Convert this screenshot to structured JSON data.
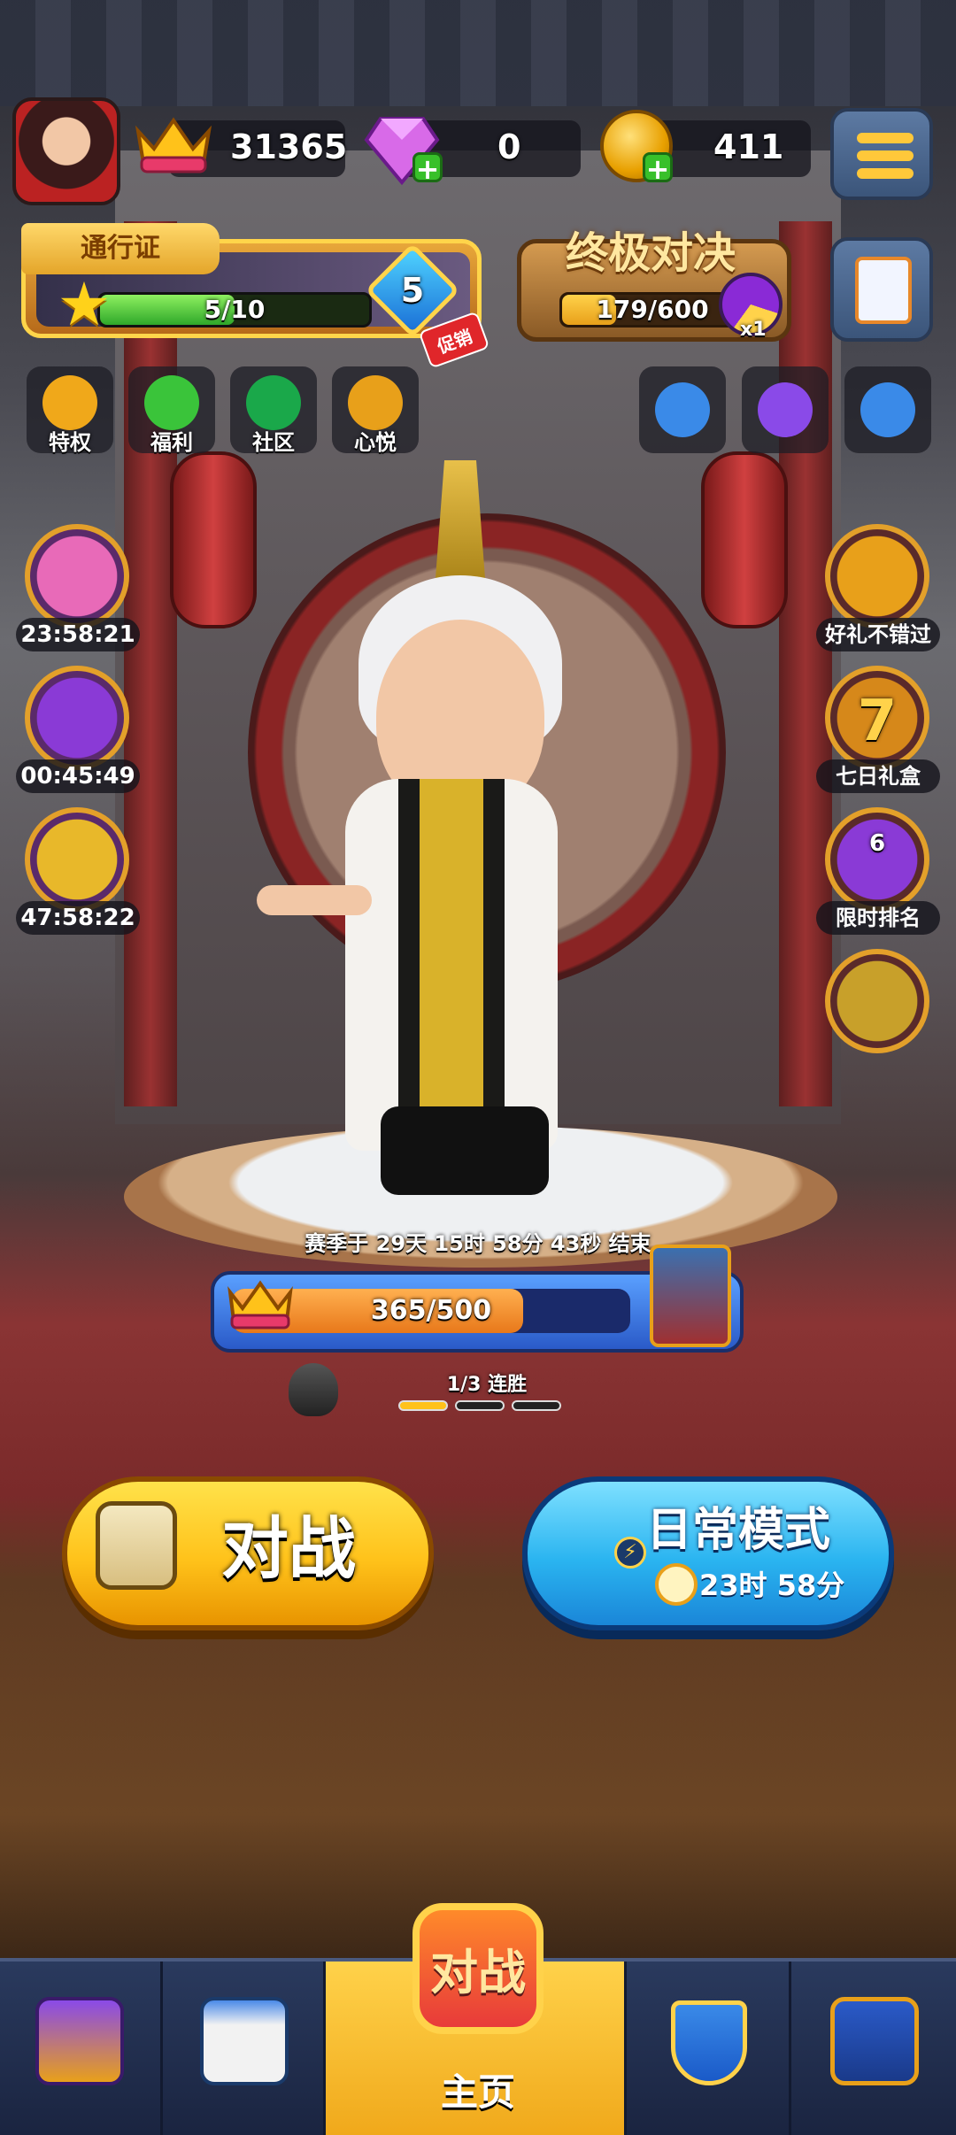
{
  "header": {
    "crowns": "31365",
    "gems": "0",
    "coins": "411"
  },
  "pass": {
    "label": "通行证",
    "progress_text": "5/10",
    "progress_fraction": 0.5,
    "level": "5",
    "promo_tag": "促销"
  },
  "ultimate_duel": {
    "title": "终极对决",
    "progress_text": "179/600",
    "progress_fraction": 0.298,
    "multiplier": "x1"
  },
  "quick_buttons": [
    {
      "label": "特权",
      "icon": "privilege-icon",
      "color": "#f0a81a"
    },
    {
      "label": "福利",
      "icon": "wechat-icon",
      "color": "#3ac43a"
    },
    {
      "label": "社区",
      "icon": "community-icon",
      "color": "#1aa84a"
    },
    {
      "label": "心悦",
      "icon": "xinyue-icon",
      "color": "#e8a01a"
    }
  ],
  "right_buttons": [
    {
      "icon": "friends-icon",
      "color": "#3a8ae8"
    },
    {
      "icon": "mystery-box-icon",
      "color": "#8a4ae8"
    },
    {
      "icon": "leaderboard-icon",
      "color": "#3a8ae8"
    }
  ],
  "left_events": [
    {
      "time": "23:58:21",
      "icon": "octopus-icon",
      "color": "#e86ab8"
    },
    {
      "time": "00:45:49",
      "icon": "calendar-icon",
      "color": "#8a3ad6"
    },
    {
      "time": "47:58:22",
      "icon": "trophy-icon",
      "color": "#e8b82a"
    }
  ],
  "right_events": [
    {
      "label": "好礼不错过",
      "icon": "megaphone-icon",
      "color": "#e8a01a"
    },
    {
      "label": "七日礼盒",
      "icon": "seven-day-gift-icon",
      "color": "#d6881a",
      "badge": "7"
    },
    {
      "label": "限时排名",
      "icon": "ranking-stars-icon",
      "color": "#8a3ad6",
      "badge": "6"
    },
    {
      "icon": "rank-emblem-icon",
      "color": "#c8a02a"
    }
  ],
  "season": {
    "text": "赛季于 29天 15时 58分 43秒 结束"
  },
  "trophy_road": {
    "progress_text": "365/500",
    "progress_fraction": 0.73
  },
  "streak": {
    "text": "1/3 连胜",
    "filled": 1,
    "total": 3
  },
  "battle_button": {
    "label": "对战"
  },
  "mode_button": {
    "title": "日常模式",
    "time": "23时 58分"
  },
  "nav": {
    "items": [
      {
        "icon": "shop-icon"
      },
      {
        "icon": "calendar-puzzle-icon"
      },
      {
        "label": "主页",
        "badge": "对战",
        "icon": "battle-badge-icon"
      },
      {
        "icon": "club-shield-icon"
      },
      {
        "icon": "collection-book-icon"
      }
    ]
  },
  "colors": {
    "accent_yellow": "#ffc21a",
    "accent_blue": "#2ab4f0",
    "progress_green": "#2fa82a"
  }
}
